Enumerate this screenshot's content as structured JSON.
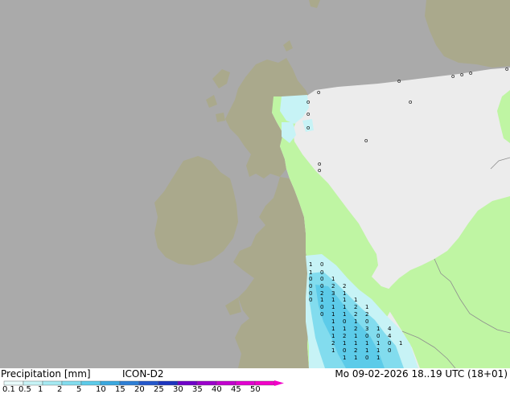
{
  "footer": {
    "title": "Precipitation [mm]",
    "model": "ICON-D2",
    "datetime": "Mo 09-02-2026 18..19 UTC (18+01)"
  },
  "legend": {
    "ticks": [
      "0.1",
      "0.5",
      "1",
      "2",
      "5",
      "10",
      "15",
      "20",
      "25",
      "30",
      "35",
      "40",
      "45",
      "50"
    ],
    "colors": [
      "#e8fbfb",
      "#c7f3f6",
      "#a5e9f2",
      "#82dcee",
      "#5ccbe9",
      "#3aa8df",
      "#2d7fd6",
      "#2458cc",
      "#1c34bf",
      "#6f00c9",
      "#9b00cc",
      "#c200cf",
      "#e100d0",
      "#f200c8"
    ]
  },
  "map_colors": {
    "sea": "#aaaaaa",
    "outside_domain_land": "#aaa98c",
    "domain_land": "#bff5a3",
    "domain_sea": "#ececec",
    "precip_light": "#c7f3f6",
    "precip_mid": "#82dcee",
    "precip_strong": "#5ccbe9"
  },
  "precip_labels": [
    "1",
    "0",
    "1",
    "0",
    "0",
    "0",
    "1",
    "0",
    "0",
    "2",
    "2",
    "0",
    "2",
    "3",
    "1",
    "0",
    "1",
    "1",
    "1",
    "1",
    "0",
    "1",
    "1",
    "2",
    "1",
    "0",
    "1",
    "1",
    "2",
    "2",
    "1",
    "0",
    "1",
    "0",
    "1",
    "1",
    "2",
    "3",
    "1",
    "4",
    "1",
    "2",
    "1",
    "0",
    "0",
    "4",
    "2",
    "1",
    "1",
    "1",
    "1",
    "0",
    "1",
    "1",
    "0",
    "2",
    "1",
    "1",
    "0",
    "1",
    "1",
    "0",
    "1"
  ]
}
